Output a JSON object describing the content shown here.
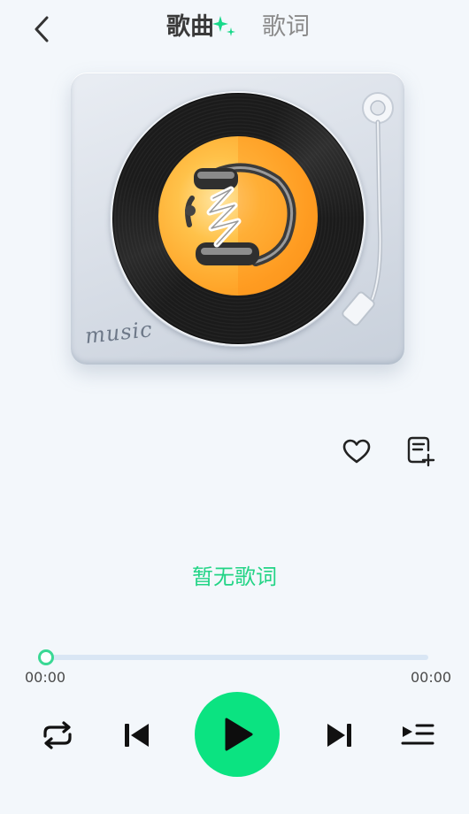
{
  "header": {
    "tabs": [
      {
        "label": "歌曲",
        "active": true
      },
      {
        "label": "歌词",
        "active": false
      }
    ]
  },
  "turntable": {
    "record_text": "music"
  },
  "lyrics": {
    "empty_text": "暂无歌词"
  },
  "player": {
    "current_time": "00:00",
    "total_time": "00:00",
    "progress": 0
  },
  "icons": {
    "back": "chevron-left-icon",
    "sparkle": "sparkle-icon",
    "like": "heart-icon",
    "add_to_playlist": "playlist-add-icon",
    "repeat": "repeat-icon",
    "previous": "skip-previous-icon",
    "play": "play-icon",
    "next": "skip-next-icon",
    "queue": "queue-icon"
  },
  "colors": {
    "accent": "#0be381",
    "accent_text": "#23d486",
    "background": "#f3f7fb"
  }
}
